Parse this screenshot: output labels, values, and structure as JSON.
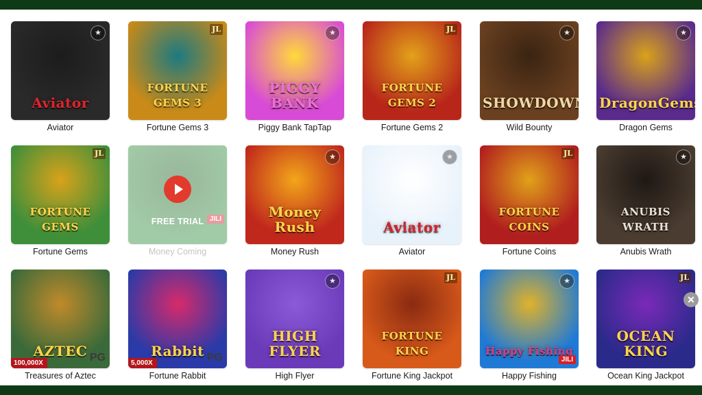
{
  "games": [
    {
      "name": "Aviator",
      "logo": "Aviator",
      "bg": "#2a2a2a",
      "bg2": "#1c1c1c",
      "logo_color": "#e0232d",
      "icon": "fav-icon"
    },
    {
      "name": "Fortune Gems 3",
      "logo": "FORTUNE GEMS 3",
      "bg": "#c98a18",
      "bg2": "#1c7a82",
      "logo_color": "#ffd44a",
      "badge": "JL"
    },
    {
      "name": "Piggy Bank TapTap",
      "logo": "PIGGY BANK",
      "bg": "#d84bd6",
      "bg2": "#ffd93a",
      "logo_color": "#f06dd6",
      "icon": "fav-icon"
    },
    {
      "name": "Fortune Gems 2",
      "logo": "FORTUNE GEMS 2",
      "bg": "#b8261a",
      "bg2": "#e2a21a",
      "logo_color": "#ffd44a",
      "badge": "JL"
    },
    {
      "name": "Wild Bounty",
      "logo": "SHOWDOWN",
      "bg": "#6a4020",
      "bg2": "#3a2412",
      "logo_color": "#f0d9a4",
      "icon": "fav-icon"
    },
    {
      "name": "Dragon Gems",
      "logo": "DragonGems",
      "bg": "#5a2b8c",
      "bg2": "#d9a21a",
      "logo_color": "#ffd44a",
      "icon": "fav-icon"
    },
    {
      "name": "Fortune Gems",
      "logo": "FORTUNE GEMS",
      "bg": "#3f8f3a",
      "bg2": "#d9a21a",
      "logo_color": "#ffd44a",
      "badge": "JL"
    },
    {
      "name": "Money Coming",
      "logo": "",
      "bg": "#2f8a3a",
      "bg2": "#1e5e24",
      "logo_color": "#ffffff",
      "trial": "FREE TRIAL",
      "jili_corner": "JILI"
    },
    {
      "name": "Money Rush",
      "logo": "Money Rush",
      "bg": "#c0281c",
      "bg2": "#f2a61a",
      "logo_color": "#ffd44a",
      "icon": "fav-icon"
    },
    {
      "name": "Aviator",
      "logo": "Aviator",
      "bg": "#e8f2fb",
      "bg2": "#ffffff",
      "logo_color": "#d3232d",
      "icon": "fav-icon"
    },
    {
      "name": "Fortune Coins",
      "logo": "FORTUNE COINS",
      "bg": "#b11e1e",
      "bg2": "#e0a21a",
      "logo_color": "#ffd44a",
      "badge": "JL"
    },
    {
      "name": "Anubis Wrath",
      "logo": "ANUBIS WRATH",
      "bg": "#4a3c30",
      "bg2": "#1e1814",
      "logo_color": "#e9e2d6",
      "icon": "fav-icon"
    },
    {
      "name": "Treasures of Aztec",
      "logo": "AZTEC",
      "bg": "#3b6a3a",
      "bg2": "#c08a2a",
      "logo_color": "#ffd44a",
      "corner": "100,000X",
      "pg": "PG"
    },
    {
      "name": "Fortune Rabbit",
      "logo": "Rabbit",
      "bg": "#2a3aa8",
      "bg2": "#d82a6a",
      "logo_color": "#ffd44a",
      "corner": "5,000X",
      "pg": "PG"
    },
    {
      "name": "High Flyer",
      "logo": "HIGH FLYER",
      "bg": "#6a3ab8",
      "bg2": "#8a5ad8",
      "logo_color": "#ffd44a",
      "icon": "fav-icon"
    },
    {
      "name": "Fortune King Jackpot",
      "logo": "FORTUNE KING",
      "bg": "#d85a1a",
      "bg2": "#8a2a12",
      "logo_color": "#ffd44a",
      "badge": "JL"
    },
    {
      "name": "Happy Fishing",
      "logo": "Happy Fishing",
      "bg": "#1f7ad6",
      "bg2": "#e0b22a",
      "logo_color": "#e23a7a",
      "icon": "fav-icon",
      "jili": "JILI"
    },
    {
      "name": "Ocean King Jackpot",
      "logo": "OCEAN KING",
      "bg": "#2a2a8a",
      "bg2": "#7a2ab8",
      "logo_color": "#ffd44a",
      "badge": "JL"
    }
  ],
  "colors": {
    "frame": "#0e3a16",
    "panel": "#ffffff"
  }
}
